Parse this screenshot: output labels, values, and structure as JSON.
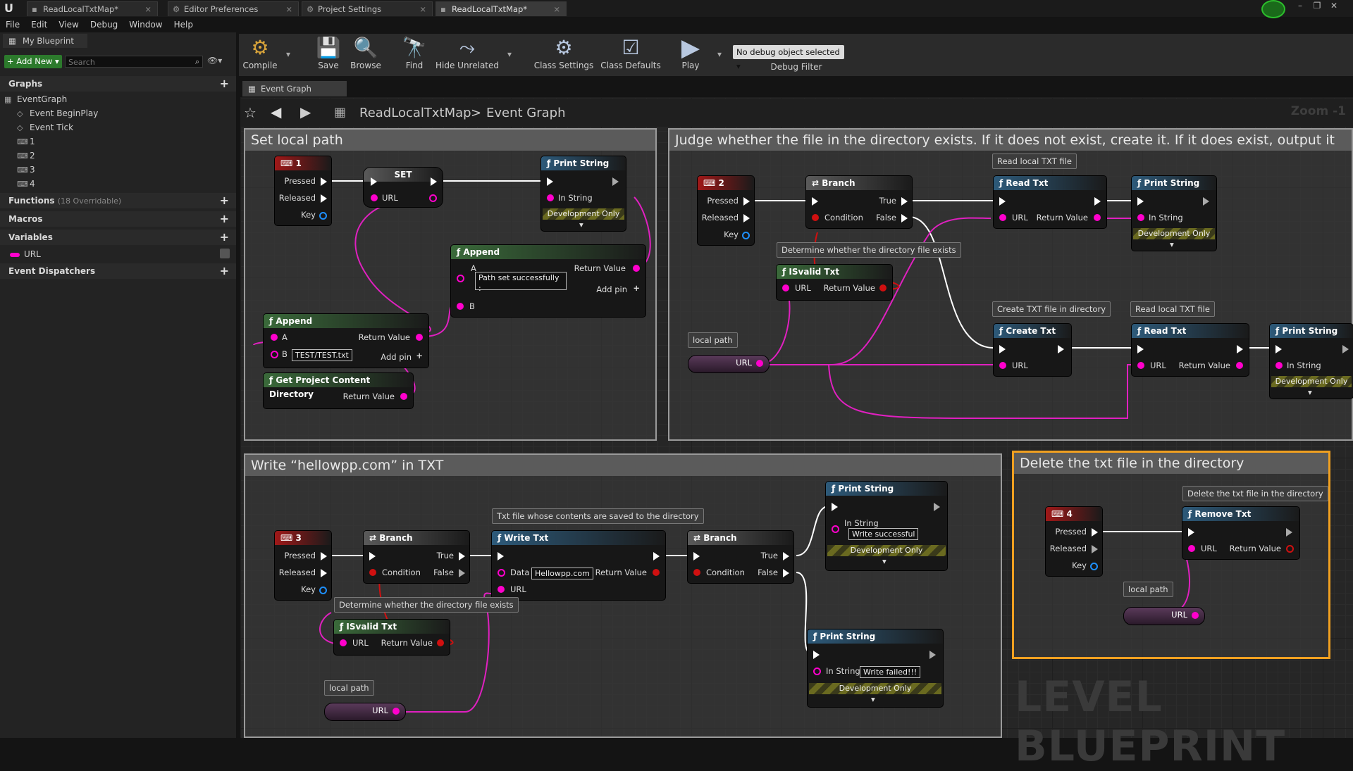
{
  "tabs": [
    {
      "label": "ReadLocalTxtMap*"
    },
    {
      "label": "Editor Preferences"
    },
    {
      "label": "Project Settings"
    },
    {
      "label": "ReadLocalTxtMap*"
    }
  ],
  "menu": [
    "File",
    "Edit",
    "View",
    "Debug",
    "Window",
    "Help"
  ],
  "left": {
    "panel_title": "My Blueprint",
    "add_new": "Add New",
    "search_placeholder": "Search",
    "graphs_header": "Graphs",
    "event_graph": "EventGraph",
    "event_begin_play": "Event BeginPlay",
    "event_tick": "Event Tick",
    "key_events": [
      "1",
      "2",
      "3",
      "4"
    ],
    "functions_header": "Functions",
    "functions_count": "(18 Overridable)",
    "macros_header": "Macros",
    "variables_header": "Variables",
    "variable_url": "URL",
    "dispatchers_header": "Event Dispatchers"
  },
  "toolbar": {
    "compile": "Compile",
    "save": "Save",
    "browse": "Browse",
    "find": "Find",
    "hide_unrelated": "Hide Unrelated",
    "class_settings": "Class Settings",
    "class_defaults": "Class Defaults",
    "play": "Play",
    "debug_object": "No debug object selected",
    "debug_filter": "Debug Filter"
  },
  "graph": {
    "tab": "Event Graph",
    "crumb_root": "ReadLocalTxtMap",
    "crumb_sep": ">",
    "crumb_leaf": "Event Graph",
    "zoom": "Zoom -1",
    "watermark": "LEVEL BLUEPRINT"
  },
  "comments": {
    "c1": "Set local path",
    "c2": "Judge whether the file in the directory exists. If it does not exist, create it. If it does exist, output it",
    "c3": "Write “hellowpp.com” in TXT",
    "c4": "Delete the txt file in the directory"
  },
  "nodes": {
    "pressed": "Pressed",
    "released": "Released",
    "key": "Key",
    "set": "SET",
    "url": "URL",
    "print_string": "Print String",
    "in_string": "In String",
    "dev_only": "Development Only",
    "append": "Append",
    "a": "A",
    "b": "B",
    "return_value": "Return Value",
    "add_pin": "Add pin",
    "path_set_ok": "Path set successfully  :",
    "test_path": "TEST/TEST.txt",
    "get_content_dir": "Get Project Content Directory",
    "branch": "Branch",
    "condition": "Condition",
    "true": "True",
    "false": "False",
    "read_txt": "Read Txt",
    "isvalid_txt": "ISvalid Txt",
    "create_txt": "Create Txt",
    "write_txt": "Write Txt",
    "remove_txt": "Remove Txt",
    "data": "Data",
    "data_value": "Hellowpp.com",
    "write_ok": "Write successful",
    "write_fail": "Write failed!!!",
    "local_path": "local path",
    "k1": "1",
    "k2": "2",
    "k3": "3",
    "k4": "4"
  },
  "bubbles": {
    "read_local": "Read local TXT file",
    "determine": "Determine whether the directory file exists",
    "create_in_dir": "Create TXT file in directory",
    "saved_to_dir": "Txt file whose contents are saved to the directory",
    "delete_in_dir": "Delete the txt file in the directory"
  }
}
